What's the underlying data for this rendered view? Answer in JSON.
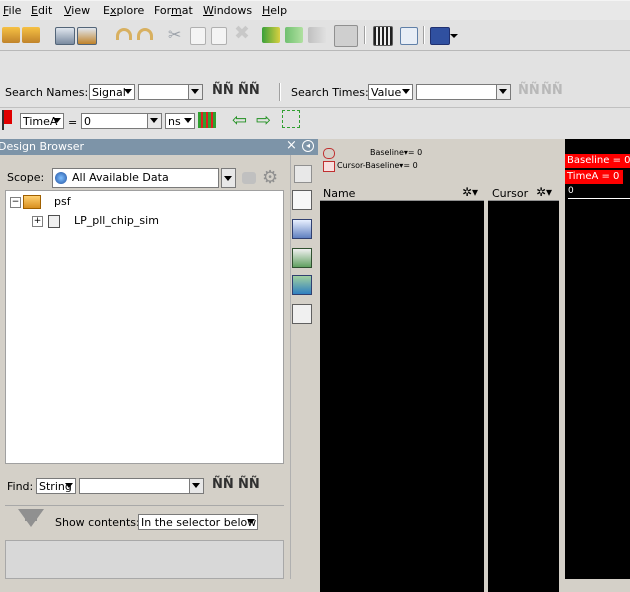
{
  "menu": [
    "File",
    "Edit",
    "View",
    "Explore",
    "Format",
    "Windows",
    "Help"
  ],
  "menu_underline": [
    "F",
    "E",
    "V",
    "x",
    "m",
    "W",
    "H"
  ],
  "search_names": {
    "label": "Search Names:",
    "type": "Signal",
    "value": ""
  },
  "search_times": {
    "label": "Search Times:",
    "type": "Value",
    "value": ""
  },
  "time_bar": {
    "marker": "TimeA",
    "eq": "=",
    "value": "0",
    "unit": "ns"
  },
  "design_browser": {
    "title": "Design Browser",
    "scope_label": "Scope:",
    "scope_value": "All Available Data",
    "tree": [
      {
        "label": "psf",
        "expanded": true
      },
      {
        "label": "LP_pll_chip_sim",
        "expanded": false
      }
    ],
    "find_label": "Find:",
    "find_type": "String",
    "find_value": "",
    "show_contents_label": "Show contents:",
    "show_contents_value": "In the selector below"
  },
  "waveform": {
    "baseline_text": "Baseline▾= 0",
    "cursor_baseline_text": "Cursor-Baseline▾= 0",
    "name_col": "Name",
    "cursor_col": "Cursor",
    "baseline_marker": "Baseline = 0",
    "timea_marker": "TimeA = 0",
    "axis_zero": "0"
  },
  "colors": {
    "accent_red": "#ff0000",
    "panel_header": "#7d94a8",
    "waveform_bg": "#000000"
  }
}
